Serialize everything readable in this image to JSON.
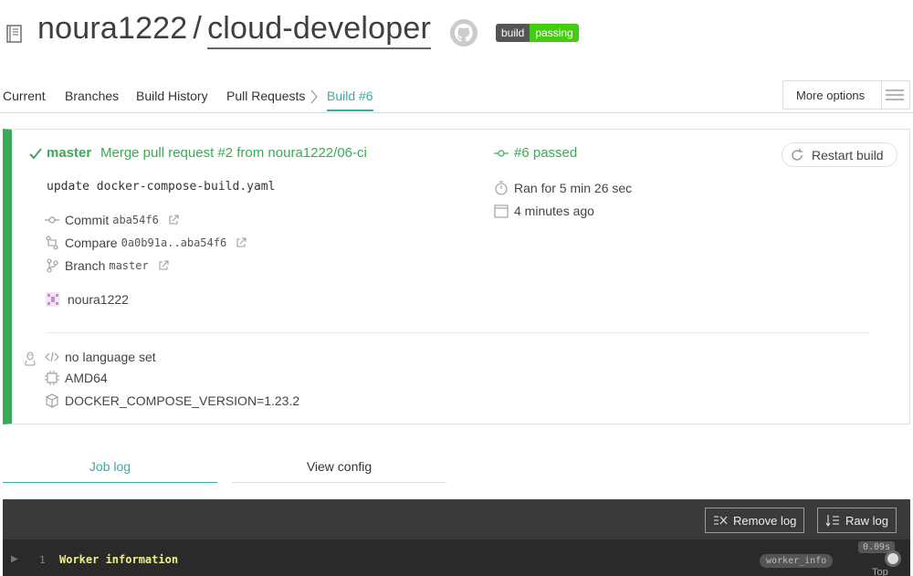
{
  "repo": {
    "owner": "noura1222",
    "separator": "/",
    "name": "cloud-developer",
    "badge_left": "build",
    "badge_right": "passing"
  },
  "tabs": {
    "current": "Current",
    "branches": "Branches",
    "build_history": "Build History",
    "pull_requests": "Pull Requests",
    "build": "Build #6",
    "more_options": "More options"
  },
  "build": {
    "branch": "master",
    "commit_message": "Merge pull request #2 from noura1222/06-ci",
    "commit_body": "update docker-compose-build.yaml",
    "commit_label": "Commit",
    "commit_sha": "aba54f6",
    "compare_label": "Compare",
    "compare_range": "0a0b91a..aba54f6",
    "branch_label": "Branch",
    "branch_value": "master",
    "author": "noura1222",
    "status": "#6 passed",
    "ran_for": "Ran for 5 min 26 sec",
    "finished_ago": "4 minutes ago",
    "restart_label": "Restart build",
    "language": "no language set",
    "arch": "AMD64",
    "env": "DOCKER_COMPOSE_VERSION=1.23.2",
    "status_color": "#39aa56"
  },
  "log_tabs": {
    "job_log": "Job log",
    "view_config": "View config"
  },
  "log": {
    "remove_label": "Remove log",
    "raw_label": "Raw log",
    "lines": [
      {
        "num": "1",
        "text": "Worker information",
        "tag": "worker_info",
        "time": "0.09s"
      }
    ],
    "top_label": "Top"
  }
}
